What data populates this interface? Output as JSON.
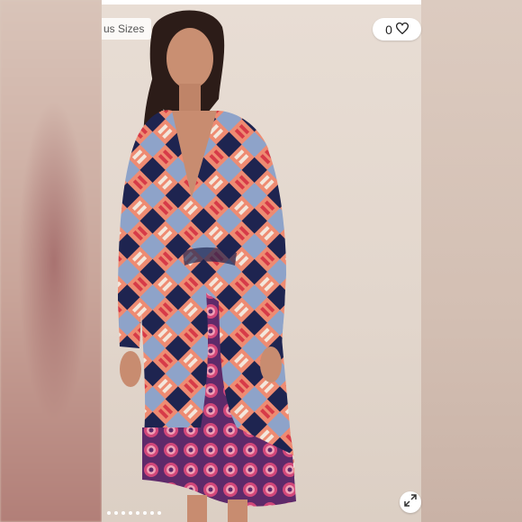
{
  "photo": {
    "sizes_tag": "us Sizes",
    "like_count": "0",
    "pagination_dots": 8
  },
  "colors": {
    "dress_coral": "#ee8b72",
    "dress_navy": "#1e2450",
    "dress_blue": "#8ea3c9",
    "dress_red": "#d73b48",
    "hem_magenta": "#8a2e6e",
    "background": "#e2d6cc"
  },
  "icons": {
    "like": "heart-icon",
    "expand": "expand-icon"
  }
}
